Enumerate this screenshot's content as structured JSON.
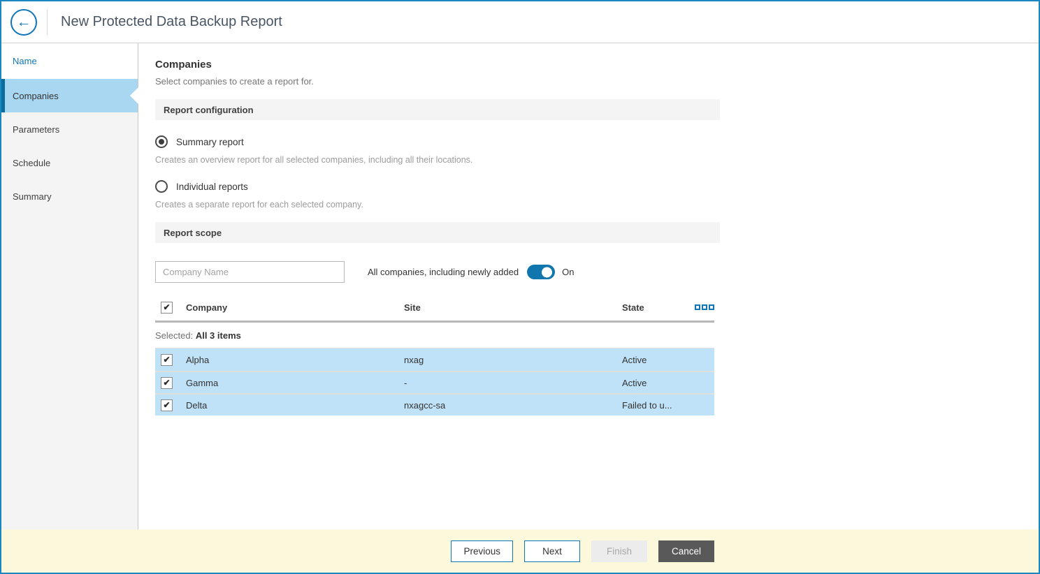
{
  "colors": {
    "accent": "#1076b8",
    "window_border": "#1b86c0",
    "active_step_bg": "#a9d7f2",
    "active_step_bar": "#0b6d9e",
    "row_highlight": "#bfe2f8",
    "section_bar_bg": "#f4f4f5",
    "footer_bg": "#fcf8db",
    "cancel_button_bg": "#595959"
  },
  "icons": {
    "back_arrow": "←",
    "check": "✔"
  },
  "header": {
    "title": "New Protected Data Backup Report"
  },
  "sidebar": {
    "items": [
      {
        "label": "Name",
        "state": "done"
      },
      {
        "label": "Companies",
        "state": "active"
      },
      {
        "label": "Parameters",
        "state": "upcoming"
      },
      {
        "label": "Schedule",
        "state": "upcoming"
      },
      {
        "label": "Summary",
        "state": "upcoming"
      }
    ]
  },
  "main": {
    "heading": "Companies",
    "subheading": "Select companies to create a report for.",
    "config": {
      "title": "Report configuration",
      "options": [
        {
          "label": "Summary report",
          "desc": "Creates an overview report for all selected companies, including all their locations.",
          "selected": true
        },
        {
          "label": "Individual reports",
          "desc": "Creates a separate report for each selected company.",
          "selected": false
        }
      ]
    },
    "scope": {
      "title": "Report scope",
      "search_placeholder": "Company Name",
      "toggle_label": "All companies, including newly added",
      "toggle_state_label": "On",
      "toggle_on": true,
      "table": {
        "columns": {
          "company": "Company",
          "site": "Site",
          "state": "State"
        },
        "selected_prefix": "Selected:",
        "selected_value": "All 3 items",
        "rows": [
          {
            "company": "Alpha",
            "site": "nxag",
            "state": "Active",
            "checked": true
          },
          {
            "company": "Gamma",
            "site": "-",
            "state": "Active",
            "checked": true
          },
          {
            "company": "Delta",
            "site": "nxagcc-sa",
            "state": "Failed to u...",
            "checked": true
          }
        ]
      }
    }
  },
  "footer": {
    "previous_label": "Previous",
    "next_label": "Next",
    "finish_label": "Finish",
    "cancel_label": "Cancel"
  }
}
